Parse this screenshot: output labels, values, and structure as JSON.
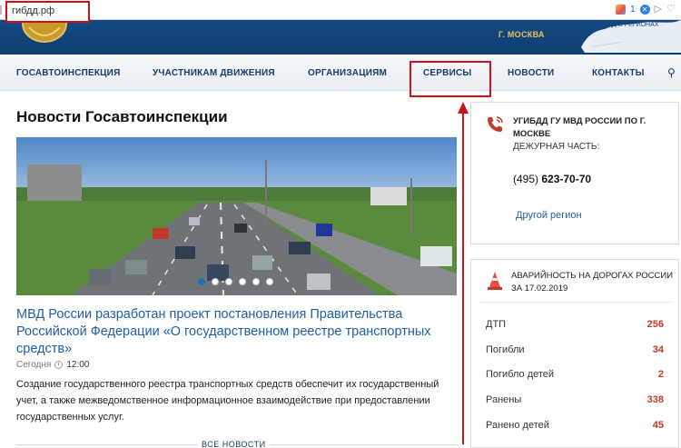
{
  "browser": {
    "url": "гибдд.рф",
    "badge_count": "1"
  },
  "header": {
    "city": "Г. МОСКВА",
    "map_label": "ГИБДД В РЕГИОНАХ"
  },
  "nav": {
    "items": [
      {
        "label": "ГОСАВТОИНСПЕКЦИЯ"
      },
      {
        "label": "УЧАСТНИКАМ ДВИЖЕНИЯ"
      },
      {
        "label": "ОРГАНИЗАЦИЯМ"
      },
      {
        "label": "СЕРВИСЫ"
      },
      {
        "label": "НОВОСТИ"
      },
      {
        "label": "КОНТАКТЫ"
      }
    ]
  },
  "main": {
    "section_title": "Новости Госавтоинспекции",
    "slider": {
      "dots": 6,
      "active": 0
    },
    "article": {
      "title": "МВД России разработан проект постановления Правительства Российской Федерации «О государственном реестре транспортных средств»",
      "date": "Сегодня",
      "time": "12:00",
      "description": "Создание государственного реестра транспортных средств обеспечит их государственный учет, а также межведомственное информационное взаимодействие при предоставлении государственных услуг."
    },
    "all_news": "ВСЕ НОВОСТИ"
  },
  "contacts": {
    "title": "УГИБДД ГУ МВД РОССИИ ПО Г. МОСКВЕ",
    "duty_label": "ДЕЖУРНАЯ ЧАСТЬ:",
    "phone_code": "(495)",
    "phone_number": "623-70-70",
    "other_region": "Другой регион"
  },
  "stats": {
    "title": "АВАРИЙНОСТЬ НА ДОРОГАХ РОССИИ ЗА 17.02.2019",
    "rows": [
      {
        "label": "ДТП",
        "value": "256"
      },
      {
        "label": "Погибли",
        "value": "34"
      },
      {
        "label": "Погибло детей",
        "value": "2"
      },
      {
        "label": "Ранены",
        "value": "338"
      },
      {
        "label": "Ранено детей",
        "value": "45"
      }
    ]
  },
  "colors": {
    "header_blue": "#134a82",
    "link_blue": "#1f5fa8",
    "annotation_red": "#d0111b",
    "stat_red": "#c0392b"
  }
}
